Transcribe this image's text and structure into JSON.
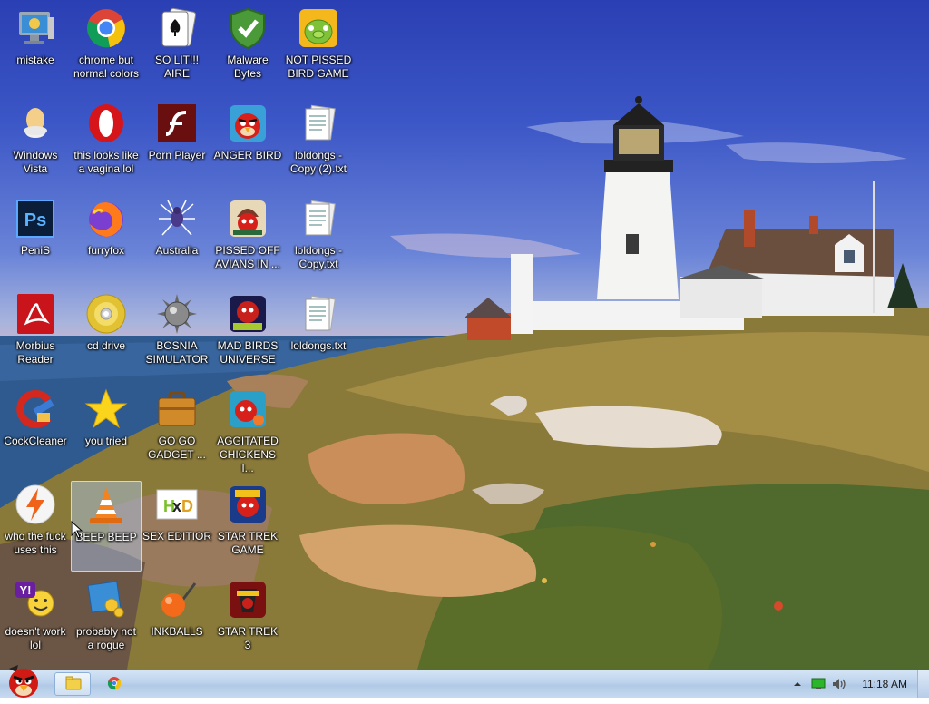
{
  "desktop": {
    "icons": [
      {
        "label": "mistake",
        "icon": "computer-icon"
      },
      {
        "label": "chrome but normal colors",
        "icon": "chrome-icon"
      },
      {
        "label": "SO LIT!!! AIRE",
        "icon": "solitaire-icon"
      },
      {
        "label": "Malware Bytes",
        "icon": "shield-icon"
      },
      {
        "label": "NOT PISSED BIRD GAME",
        "icon": "green-pig-icon"
      },
      {
        "label": "Windows Vista",
        "icon": "egg-icon"
      },
      {
        "label": "this looks like a vagina lol",
        "icon": "opera-icon"
      },
      {
        "label": "Porn Player",
        "icon": "flash-icon"
      },
      {
        "label": "ANGER BIRD",
        "icon": "angry-bird-icon"
      },
      {
        "label": "loldongs - Copy (2).txt",
        "icon": "text-file-icon"
      },
      {
        "label": "PeniS",
        "icon": "photoshop-icon"
      },
      {
        "label": "furryfox",
        "icon": "firefox-icon"
      },
      {
        "label": "Australia",
        "icon": "spider-solitaire-icon"
      },
      {
        "label": "PISSED OFF AVIANS IN ...",
        "icon": "angry-birds-seasons-icon"
      },
      {
        "label": "loldongs - Copy.txt",
        "icon": "text-file-icon"
      },
      {
        "label": "Morbius Reader",
        "icon": "pdf-reader-icon"
      },
      {
        "label": "cd drive",
        "icon": "cd-icon"
      },
      {
        "label": "BOSNIA SIMULATOR",
        "icon": "mine-icon"
      },
      {
        "label": "MAD BIRDS UNIVERSE",
        "icon": "angry-birds-space-icon"
      },
      {
        "label": "loldongs.txt",
        "icon": "text-file-icon"
      },
      {
        "label": "CockCleaner",
        "icon": "ccleaner-icon"
      },
      {
        "label": "you tried",
        "icon": "star-icon"
      },
      {
        "label": "GO GO GADGET ...",
        "icon": "briefcase-icon"
      },
      {
        "label": "AGGITATED CHICKENS I...",
        "icon": "angry-birds-rio-icon"
      },
      {
        "label": "who the fuck uses this",
        "icon": "winamp-icon"
      },
      {
        "label": "BEEP BEEP",
        "icon": "vlc-icon"
      },
      {
        "label": "SEX EDITIOR",
        "icon": "hxd-icon"
      },
      {
        "label": "STAR TREK GAME",
        "icon": "angry-birds-star-wars-icon"
      },
      {
        "label": "doesn't work lol",
        "icon": "yahoo-messenger-icon"
      },
      {
        "label": "probably not a rogue",
        "icon": "control-panel-icon"
      },
      {
        "label": "INKBALLS",
        "icon": "inkball-icon"
      },
      {
        "label": "STAR TREK 3",
        "icon": "angry-birds-star-wars-2-icon"
      }
    ]
  },
  "taskbar": {
    "start_icon": "angry-bird-start-icon",
    "pinned": [
      "explorer-icon",
      "chrome-icon"
    ],
    "tray": {
      "icons": [
        "show-hidden-icon",
        "network-icon",
        "volume-icon"
      ],
      "clock": "11:18 AM"
    }
  },
  "colors": {
    "taskbar": "#bcd2ec",
    "label_text": "#ffffff"
  }
}
